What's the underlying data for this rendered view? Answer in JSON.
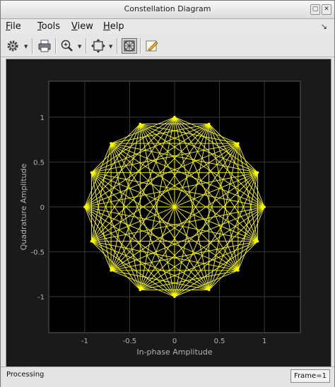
{
  "window": {
    "title": "Constellation Diagram"
  },
  "menu": {
    "items": [
      {
        "label": "File",
        "key": "F",
        "rest": "ile"
      },
      {
        "label": "Tools",
        "key": "T",
        "rest": "ools"
      },
      {
        "label": "View",
        "key": "V",
        "rest": "iew"
      },
      {
        "label": "Help",
        "key": "H",
        "rest": "elp"
      }
    ]
  },
  "toolbar": {
    "icons": [
      "gear-icon",
      "print-icon",
      "zoom-in-icon",
      "fit-to-view-icon",
      "constellation-view-icon",
      "edit-icon"
    ]
  },
  "status": {
    "text": "Processing",
    "frame": "Frame=1"
  },
  "colors": {
    "plot_background": "#000000",
    "figure_background": "#1a1a1a",
    "grid": "#3a3a3a",
    "trace": "#ffff00",
    "axis_text": "#b3b3b3"
  },
  "chart_data": {
    "type": "line",
    "title": "",
    "xlabel": "In-phase Amplitude",
    "ylabel": "Quadrature Amplitude",
    "xlim": [
      -1.4,
      1.4
    ],
    "ylim": [
      -1.4,
      1.4
    ],
    "xticks": [
      -1,
      -0.5,
      0,
      0.5,
      1
    ],
    "yticks": [
      -1,
      -0.5,
      0,
      0.5,
      1
    ],
    "xtick_labels": [
      "-1",
      "-0.5",
      "0",
      "0.5",
      "1"
    ],
    "ytick_labels": [
      "-1",
      "-0.5",
      "0",
      "0.5",
      "1"
    ],
    "grid": true,
    "series": [
      {
        "symbols": [
          [
            1,
            0
          ],
          [
            0.924,
            0.383
          ],
          [
            0.707,
            0.707
          ],
          [
            0.383,
            0.924
          ],
          [
            0,
            1
          ],
          [
            -0.383,
            0.924
          ],
          [
            -0.707,
            0.707
          ],
          [
            -0.924,
            0.383
          ],
          [
            -1,
            0
          ],
          [
            -0.924,
            -0.383
          ],
          [
            -0.707,
            -0.707
          ],
          [
            -0.383,
            -0.924
          ],
          [
            0,
            -1
          ],
          [
            0.383,
            -0.924
          ],
          [
            0.707,
            -0.707
          ],
          [
            0.924,
            -0.383
          ]
        ],
        "transition_steps": [
          2,
          3,
          4,
          5,
          6,
          7,
          8
        ]
      }
    ]
  }
}
